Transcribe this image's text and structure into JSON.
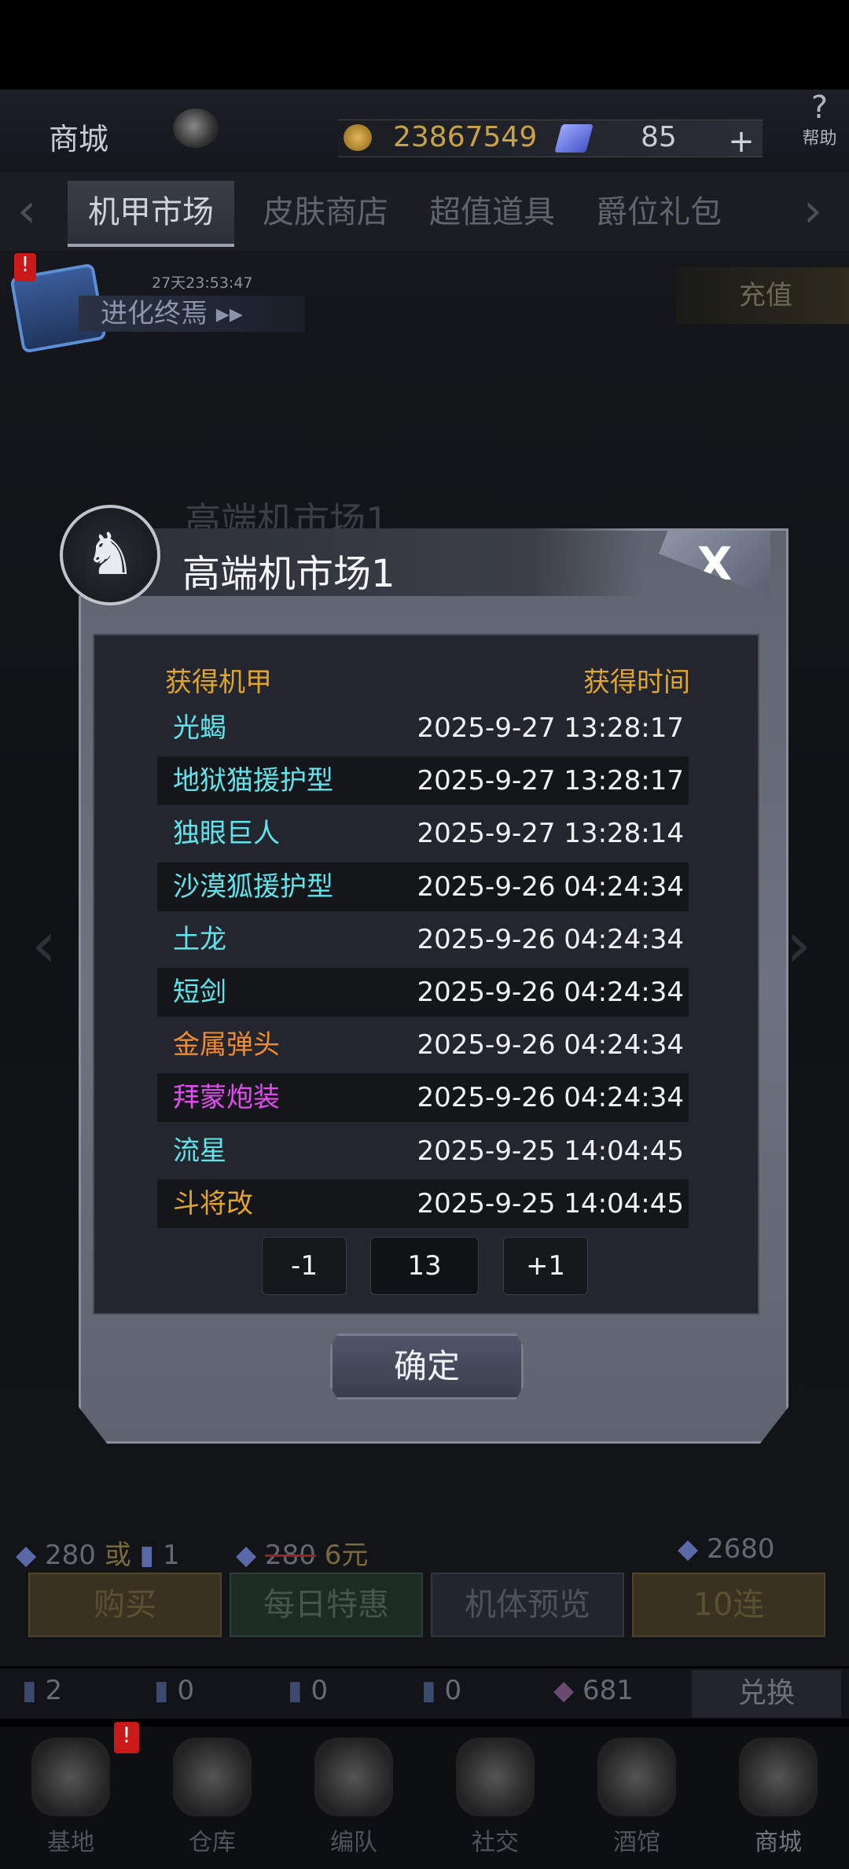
{
  "colors": {
    "cyan": "#60e4ec",
    "orange": "#f08a2e",
    "purple": "#e24bf0",
    "gold": "#e0a52a"
  },
  "header": {
    "title": "商城",
    "gold": "23867549",
    "gems": "85",
    "plus": "+",
    "help_icon": "?",
    "help": "帮助"
  },
  "tabs": [
    {
      "label": "机甲市场",
      "active": true
    },
    {
      "label": "皮肤商店"
    },
    {
      "label": "超值道具"
    },
    {
      "label": "爵位礼包"
    }
  ],
  "tab_arrows": {
    "left": "‹",
    "right": "›"
  },
  "event": {
    "badge": "!",
    "timer": "27天23:53:47",
    "label": "进化终焉 ▸▸"
  },
  "recharge": {
    "label": "充值"
  },
  "background_title": "高端机市场1",
  "side_arrows": {
    "left": "‹",
    "right": "›"
  },
  "dialog": {
    "title": "高端机市场1",
    "close": "X",
    "emblem": "♞",
    "col_mecha": "获得机甲",
    "col_time": "获得时间",
    "rows": [
      {
        "name": "光蝎",
        "time": "2025-9-27 13:28:17",
        "color": "cyan"
      },
      {
        "name": "地狱猫援护型",
        "time": "2025-9-27 13:28:17",
        "color": "cyan"
      },
      {
        "name": "独眼巨人",
        "time": "2025-9-27 13:28:14",
        "color": "cyan"
      },
      {
        "name": "沙漠狐援护型",
        "time": "2025-9-26 04:24:34",
        "color": "cyan"
      },
      {
        "name": "土龙",
        "time": "2025-9-26 04:24:34",
        "color": "cyan"
      },
      {
        "name": "短剑",
        "time": "2025-9-26 04:24:34",
        "color": "cyan"
      },
      {
        "name": "金属弹头",
        "time": "2025-9-26 04:24:34",
        "color": "orange"
      },
      {
        "name": "拜蒙炮装",
        "time": "2025-9-26 04:24:34",
        "color": "purple"
      },
      {
        "name": "流星",
        "time": "2025-9-25 14:04:45",
        "color": "cyan"
      },
      {
        "name": "斗将改",
        "time": "2025-9-25 14:04:45",
        "color": "gold"
      }
    ],
    "minus": "-1",
    "page": "13",
    "plus": "+1",
    "confirm": "确定"
  },
  "prices": {
    "a": "280",
    "or": "或",
    "b": "1",
    "old": "280",
    "rmb": "6元",
    "ten": "2680"
  },
  "buttons": {
    "buy": "购买",
    "daily": "每日特惠",
    "preview": "机体预览",
    "ten": "10连"
  },
  "inventory": {
    "i1": "2",
    "i2": "0",
    "i3": "0",
    "i4": "0",
    "i5": "681",
    "exchange": "兑换"
  },
  "nav": [
    {
      "label": "基地"
    },
    {
      "label": "仓库"
    },
    {
      "label": "编队"
    },
    {
      "label": "社交"
    },
    {
      "label": "酒馆"
    },
    {
      "label": "商城",
      "active": true
    }
  ],
  "nav_badge": "!"
}
